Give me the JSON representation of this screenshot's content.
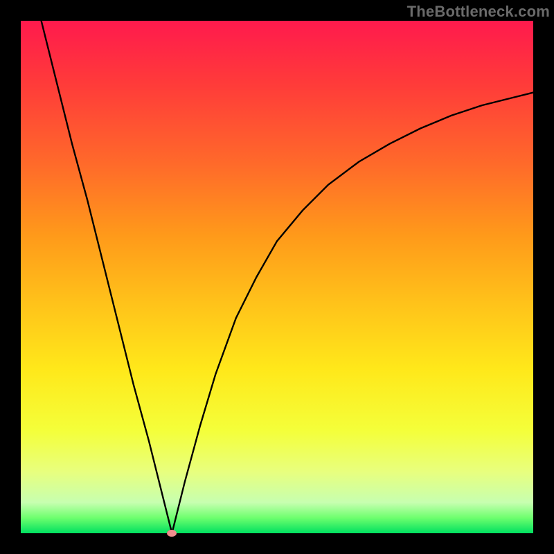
{
  "watermark": "TheBottleneck.com",
  "chart_data": {
    "type": "line",
    "title": "",
    "xlabel": "",
    "ylabel": "",
    "xlim": [
      0,
      100
    ],
    "ylim": [
      0,
      100
    ],
    "grid": false,
    "legend": false,
    "series": [
      {
        "name": "left-branch",
        "x": [
          4,
          7,
          10,
          13,
          16,
          19,
          22,
          25,
          28,
          29.5
        ],
        "values": [
          100,
          88,
          76,
          65,
          53,
          41,
          29,
          18,
          6,
          0
        ]
      },
      {
        "name": "right-branch",
        "x": [
          29.5,
          32,
          35,
          38,
          42,
          46,
          50,
          55,
          60,
          66,
          72,
          78,
          84,
          90,
          96,
          100
        ],
        "values": [
          0,
          10,
          21,
          31,
          42,
          50,
          57,
          63,
          68,
          72.5,
          76,
          79,
          81.5,
          83.5,
          85,
          86
        ]
      }
    ],
    "marker": {
      "x": 29.5,
      "y": 0
    },
    "background_gradient": {
      "stops": [
        {
          "pos": 0.0,
          "color": "#ff1a4d"
        },
        {
          "pos": 0.12,
          "color": "#ff3a3a"
        },
        {
          "pos": 0.28,
          "color": "#ff6a2a"
        },
        {
          "pos": 0.42,
          "color": "#ff9a1a"
        },
        {
          "pos": 0.55,
          "color": "#ffc21a"
        },
        {
          "pos": 0.68,
          "color": "#ffe81a"
        },
        {
          "pos": 0.8,
          "color": "#f4ff3a"
        },
        {
          "pos": 0.88,
          "color": "#e8ff7e"
        },
        {
          "pos": 0.94,
          "color": "#c7ffb0"
        },
        {
          "pos": 0.97,
          "color": "#6eff6e"
        },
        {
          "pos": 1.0,
          "color": "#00e060"
        }
      ]
    }
  }
}
